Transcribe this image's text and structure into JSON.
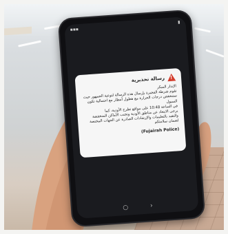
{
  "alert": {
    "title": "رسالة تحذيرية",
    "body_lines": [
      "الإنذار المبكر",
      "تقوم شرطة الفجيرة بإرسال هذه الرسالة لتوعية الجمهور حيث",
      "ستنخفض درجات الحرارة مع هطول أمطار مع احتمالية تكون السيول",
      "في الساعة 10:48 على مواقع تطرح الأودية، كما",
      "يرجى الابتعاد عن مناطق الأودية وتجنب الأماكن المنخفضة",
      "والتقيد بالتعليمات والإرشادات الصادرة عن الجهات المختصة",
      "لضمان سلامتكم"
    ],
    "signature": "(Fujairah Police)"
  },
  "phone": {
    "nav": [
      "○",
      "›"
    ]
  },
  "colors": {
    "alert_icon": "#d33c2c",
    "dialog_bg": "#f6f6f6",
    "phone_body": "#0f0f12"
  }
}
